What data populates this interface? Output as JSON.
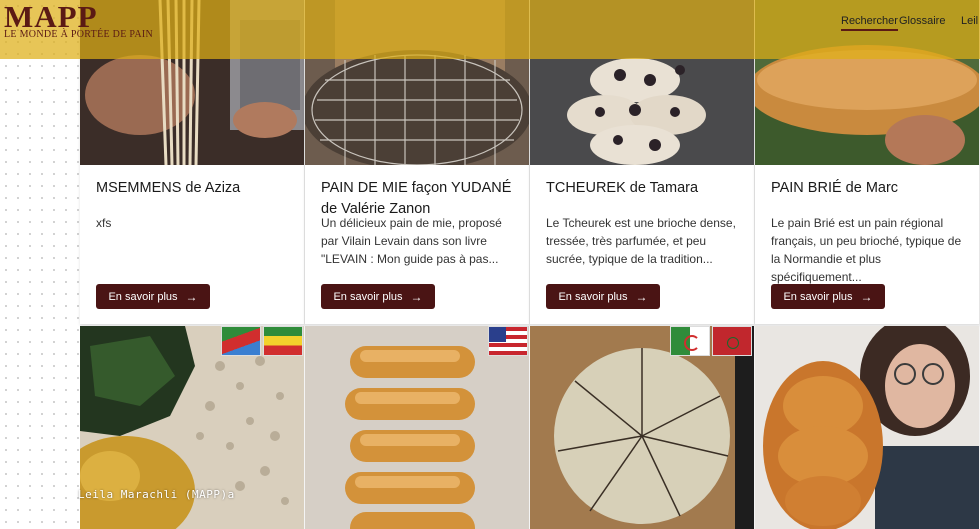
{
  "header": {
    "logo": "MAPP",
    "tagline": "LE MONDE À PORTÉE DE PAIN",
    "nav": [
      "Rechercher",
      "Glossaire",
      "Leil"
    ]
  },
  "cards": [
    {
      "title": "MSEMMENS de Aziza",
      "desc": "xfs",
      "button": "En savoir plus"
    },
    {
      "title": "PAIN DE MIE façon YUDANÉ de Valérie Zanon",
      "desc": "Un délicieux pain de mie, proposé par Vilain Levain dans son livre \"LEVAIN : Mon guide pas à pas...",
      "button": "En savoir plus"
    },
    {
      "title": "TCHEUREK de Tamara",
      "desc": "Le Tcheurek est une brioche dense, tressée, très parfumée, et peu sucrée, typique de la tradition...",
      "button": "En savoir plus"
    },
    {
      "title": "PAIN BRIÉ de Marc",
      "desc": "Le pain Brié est un pain régional français, un peu brioché, typique de la Normandie et plus spécifiquement...",
      "button": "En savoir plus"
    }
  ],
  "photo_watermark": "Leila Marachli (MAPP)a",
  "colors": {
    "header": "#deaf16",
    "brand": "#5b1a14",
    "button": "#4a1414"
  },
  "icons": [
    "arrow-right-icon",
    "flag-eritrea-icon",
    "flag-ethiopia-icon",
    "flag-usa-icon",
    "flag-algeria-icon",
    "flag-morocco-icon"
  ]
}
